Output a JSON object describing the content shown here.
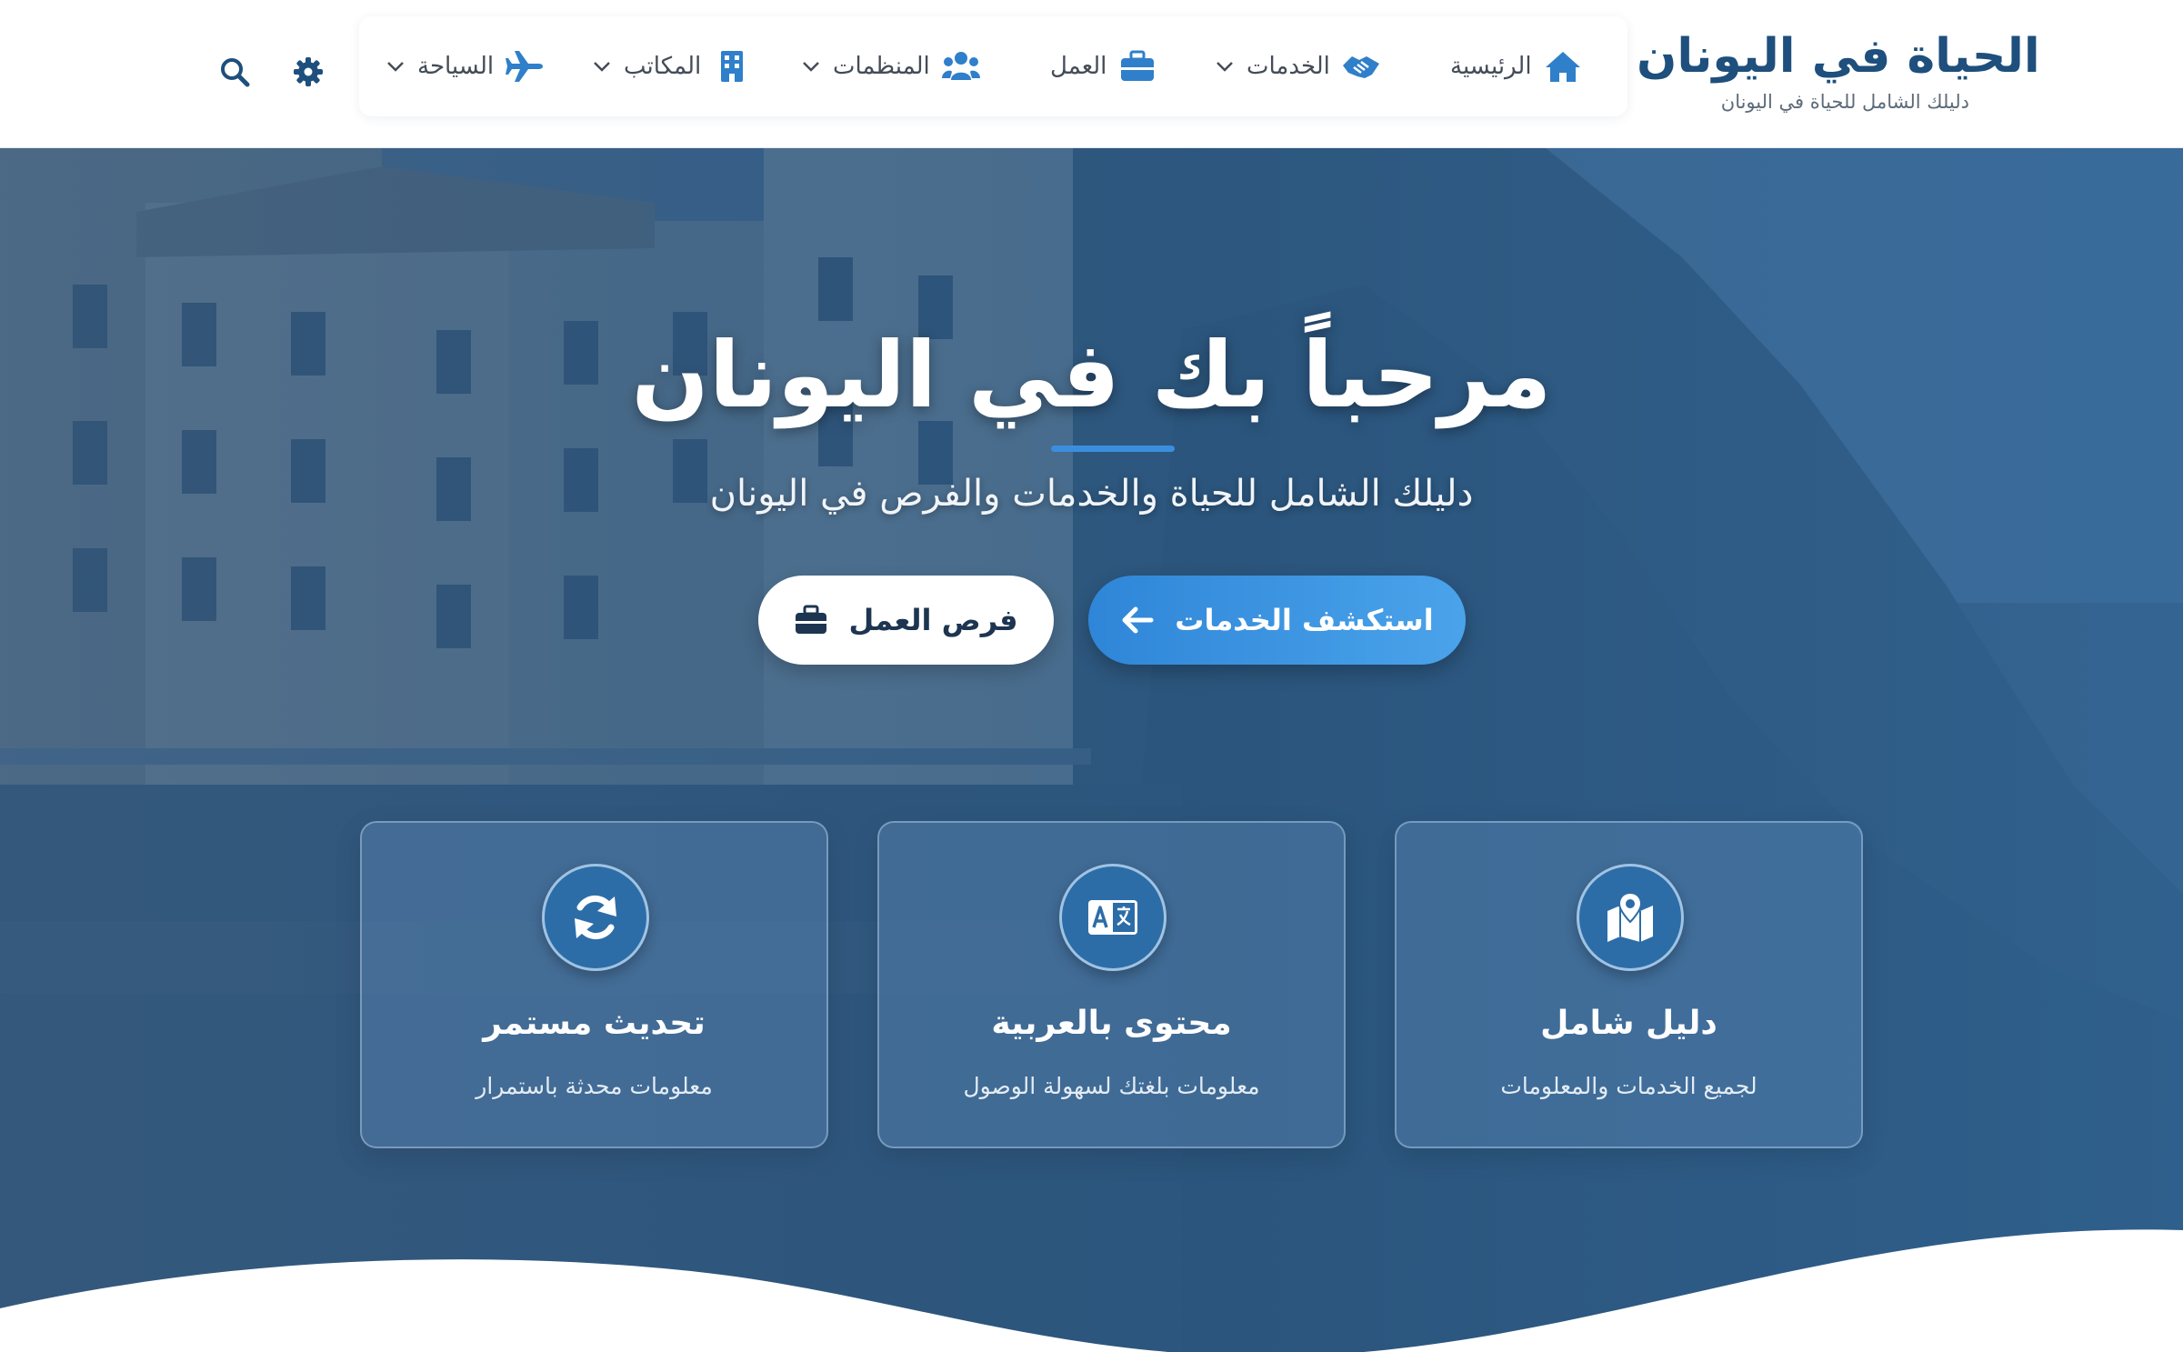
{
  "brand": {
    "title": "الحياة في اليونان",
    "tagline": "دليلك الشامل للحياة في اليونان",
    "logo_icon": "globe-icon"
  },
  "nav": {
    "items": [
      {
        "label": "الرئيسية",
        "icon": "home-icon",
        "has_dropdown": false
      },
      {
        "label": "الخدمات",
        "icon": "handshake-icon",
        "has_dropdown": true
      },
      {
        "label": "العمل",
        "icon": "briefcase-icon",
        "has_dropdown": false
      },
      {
        "label": "المنظمات",
        "icon": "users-icon",
        "has_dropdown": true
      },
      {
        "label": "المكاتب",
        "icon": "building-icon",
        "has_dropdown": true
      },
      {
        "label": "السياحة",
        "icon": "plane-icon",
        "has_dropdown": true
      }
    ],
    "tools": [
      {
        "icon": "gear-icon"
      },
      {
        "icon": "search-icon"
      }
    ]
  },
  "hero": {
    "title": "مرحباً بك في اليونان",
    "subtitle": "دليلك الشامل للحياة والخدمات والفرص في اليونان",
    "primary_button": {
      "label": "استكشف الخدمات",
      "icon": "arrow-left-icon"
    },
    "secondary_button": {
      "label": "فرص العمل",
      "icon": "briefcase-icon"
    }
  },
  "features": [
    {
      "title": "دليل شامل",
      "desc": "لجميع الخدمات والمعلومات",
      "icon": "map-marker-icon"
    },
    {
      "title": "محتوى بالعربية",
      "desc": "معلومات بلغتك لسهولة الوصول",
      "icon": "language-icon"
    },
    {
      "title": "تحديث مستمر",
      "desc": "معلومات محدثة باستمرار",
      "icon": "sync-icon"
    }
  ],
  "colors": {
    "brand_blue": "#1e4f7d",
    "accent_blue": "#3b8ede",
    "icon_blue": "#2f7fca",
    "hero_overlay": "#2a5a8c"
  }
}
